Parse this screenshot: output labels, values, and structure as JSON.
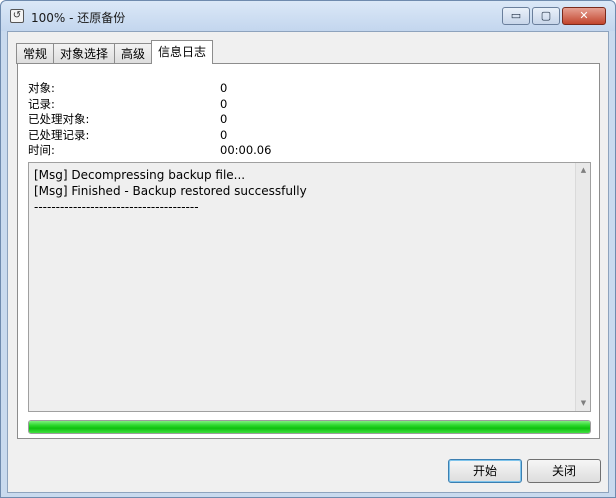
{
  "window": {
    "title": "100% - 还原备份",
    "icon": "restore-app-icon",
    "caption": {
      "minimize": "▭",
      "maximize": "▢",
      "close": "✕"
    }
  },
  "tabs": [
    {
      "label": "常规",
      "active": false
    },
    {
      "label": "对象选择",
      "active": false
    },
    {
      "label": "高级",
      "active": false
    },
    {
      "label": "信息日志",
      "active": true
    }
  ],
  "stats": [
    {
      "label": "对象:",
      "value": "0"
    },
    {
      "label": "记录:",
      "value": "0"
    },
    {
      "label": "已处理对象:",
      "value": "0"
    },
    {
      "label": "已处理记录:",
      "value": "0"
    },
    {
      "label": "时间:",
      "value": "00:00.06"
    }
  ],
  "log": {
    "lines": [
      "[Msg] Decompressing backup file...",
      "[Msg] Finished - Backup restored successfully",
      "--------------------------------------"
    ]
  },
  "progress": {
    "percent": 100,
    "color": "#1fcc1f"
  },
  "buttons": {
    "start": "开始",
    "close": "关闭"
  }
}
